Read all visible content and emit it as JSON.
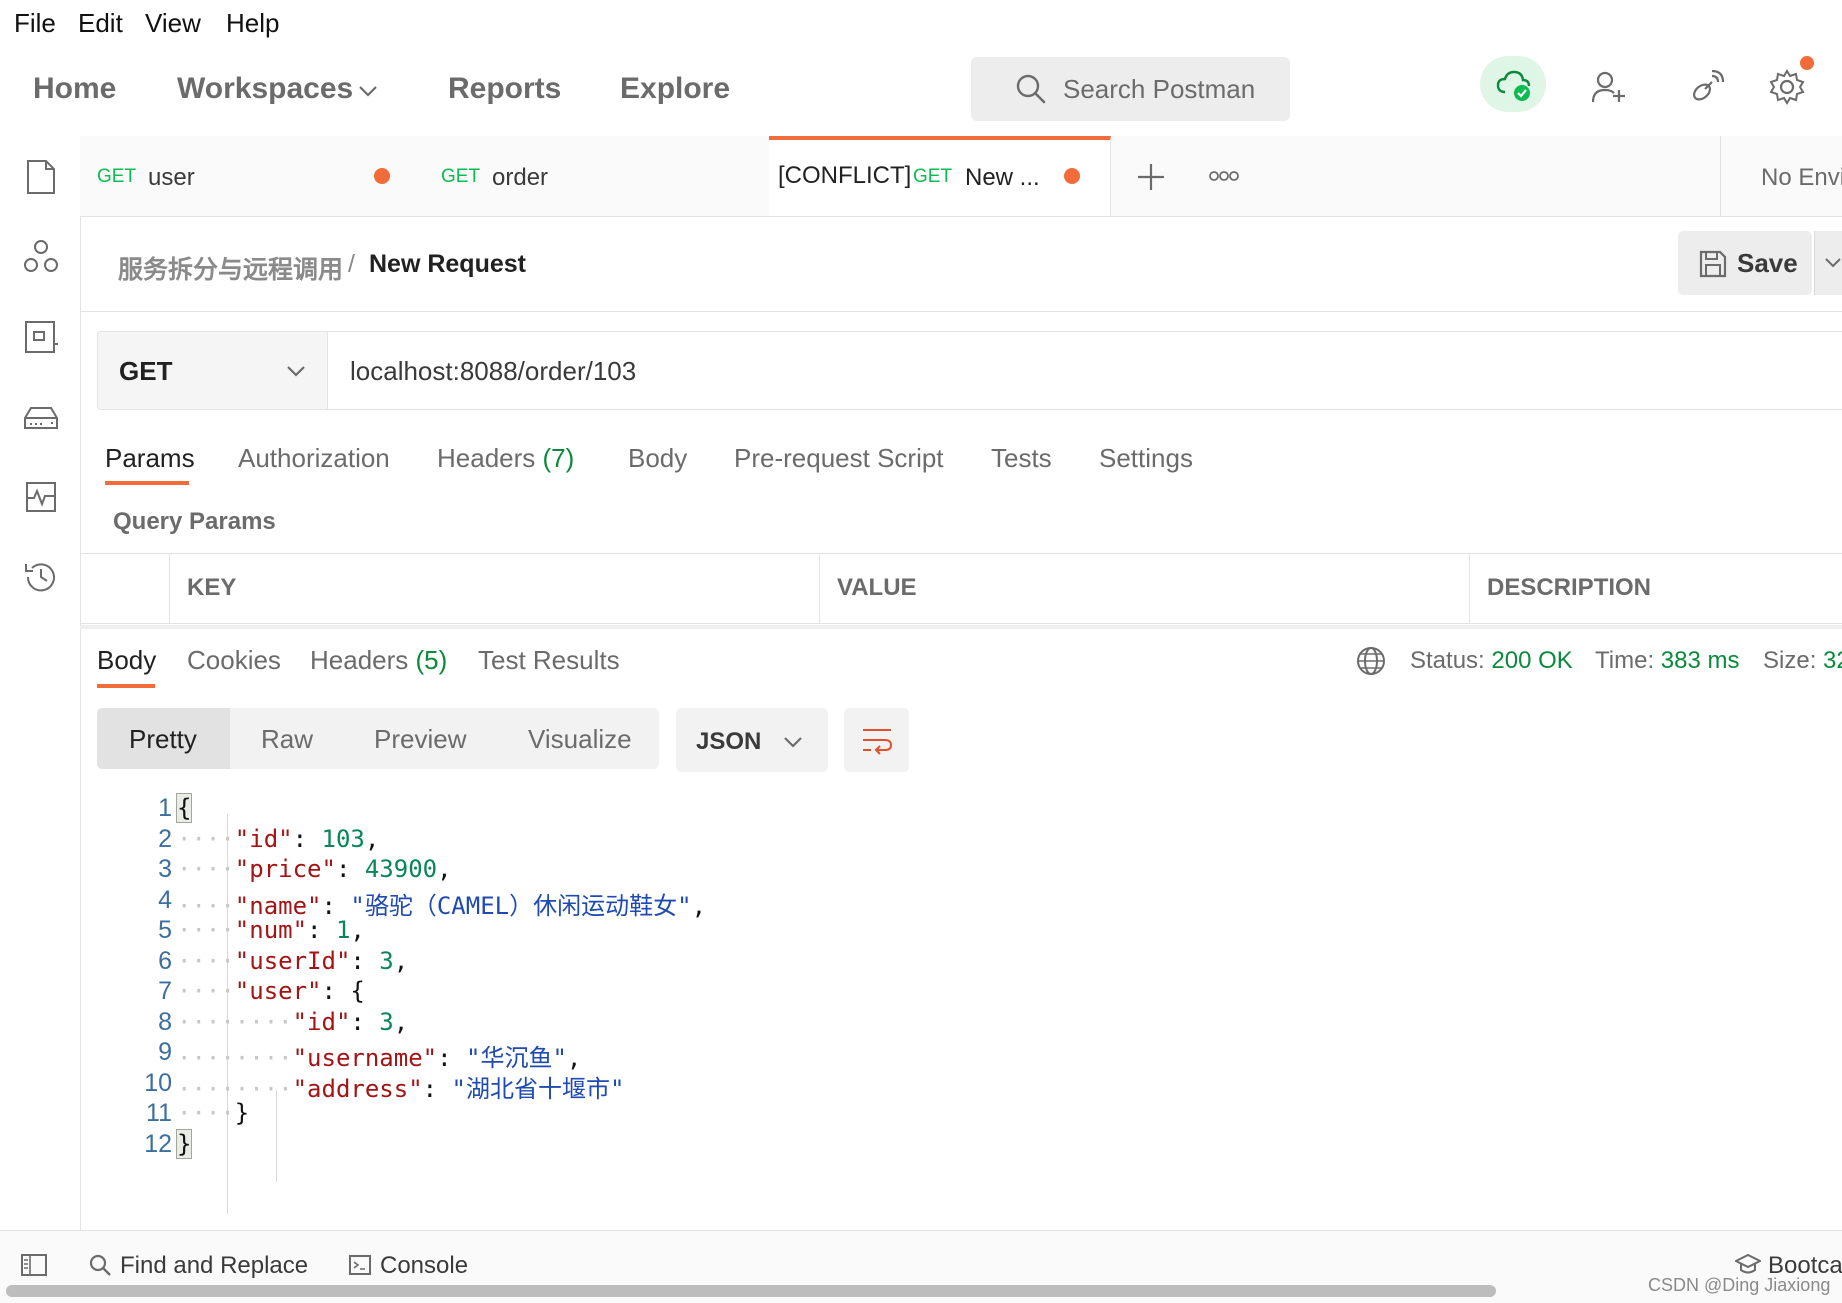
{
  "menu": {
    "file": "File",
    "edit": "Edit",
    "view": "View",
    "help": "Help"
  },
  "nav": {
    "home": "Home",
    "workspaces": "Workspaces",
    "reports": "Reports",
    "explore": "Explore",
    "search_placeholder": "Search Postman"
  },
  "tabs": [
    {
      "method": "GET",
      "name": "user",
      "conflict": "",
      "unsaved": true
    },
    {
      "method": "GET",
      "name": "order",
      "conflict": "",
      "unsaved": false
    },
    {
      "method": "GET",
      "name": "New ...",
      "conflict": "[CONFLICT]",
      "unsaved": true
    }
  ],
  "environment": "No Envi",
  "breadcrumb": {
    "collection": "服务拆分与远程调用",
    "separator": "/",
    "request": "New Request"
  },
  "save_label": "Save",
  "request": {
    "method": "GET",
    "url": "localhost:8088/order/103"
  },
  "request_tabs": {
    "params": "Params",
    "authorization": "Authorization",
    "headers": "Headers",
    "headers_count": "(7)",
    "body": "Body",
    "prerequest": "Pre-request Script",
    "tests": "Tests",
    "settings": "Settings"
  },
  "query_params": {
    "title": "Query Params",
    "columns": {
      "key": "KEY",
      "value": "VALUE",
      "description": "DESCRIPTION"
    }
  },
  "response_tabs": {
    "body": "Body",
    "cookies": "Cookies",
    "headers": "Headers",
    "headers_count": "(5)",
    "test_results": "Test Results"
  },
  "status": {
    "status_label": "Status:",
    "status_value": "200 OK",
    "time_label": "Time:",
    "time_value": "383 ms",
    "size_label": "Size:",
    "size_value": "32"
  },
  "view_modes": {
    "pretty": "Pretty",
    "raw": "Raw",
    "preview": "Preview",
    "visualize": "Visualize"
  },
  "format": "JSON",
  "code": {
    "line_numbers": [
      "1",
      "2",
      "3",
      "4",
      "5",
      "6",
      "7",
      "8",
      "9",
      "10",
      "11",
      "12"
    ],
    "open_brace": "{",
    "close_brace": "}",
    "nested_open": "{",
    "nested_close": "}",
    "k_id": "\"id\"",
    "v_id": "103",
    "k_price": "\"price\"",
    "v_price": "43900",
    "k_name": "\"name\"",
    "v_name": "\"骆驼（CAMEL）休闲运动鞋女\"",
    "k_num": "\"num\"",
    "v_num": "1",
    "k_userId": "\"userId\"",
    "v_userId": "3",
    "k_user": "\"user\"",
    "k_user_id": "\"id\"",
    "v_user_id": "3",
    "k_username": "\"username\"",
    "v_username": "\"华沉鱼\"",
    "k_address": "\"address\"",
    "v_address": "\"湖北省十堰市\""
  },
  "footer": {
    "find_replace": "Find and Replace",
    "console": "Console",
    "bootcamp": "Bootca",
    "watermark": "CSDN @Ding Jiaxiong"
  },
  "colors": {
    "accent": "#f26b3a",
    "method_get": "#0cbb52",
    "status_ok": "#0b8a3c",
    "json_key": "#a31515",
    "json_number": "#098658",
    "json_string": "#1f4bb0"
  }
}
